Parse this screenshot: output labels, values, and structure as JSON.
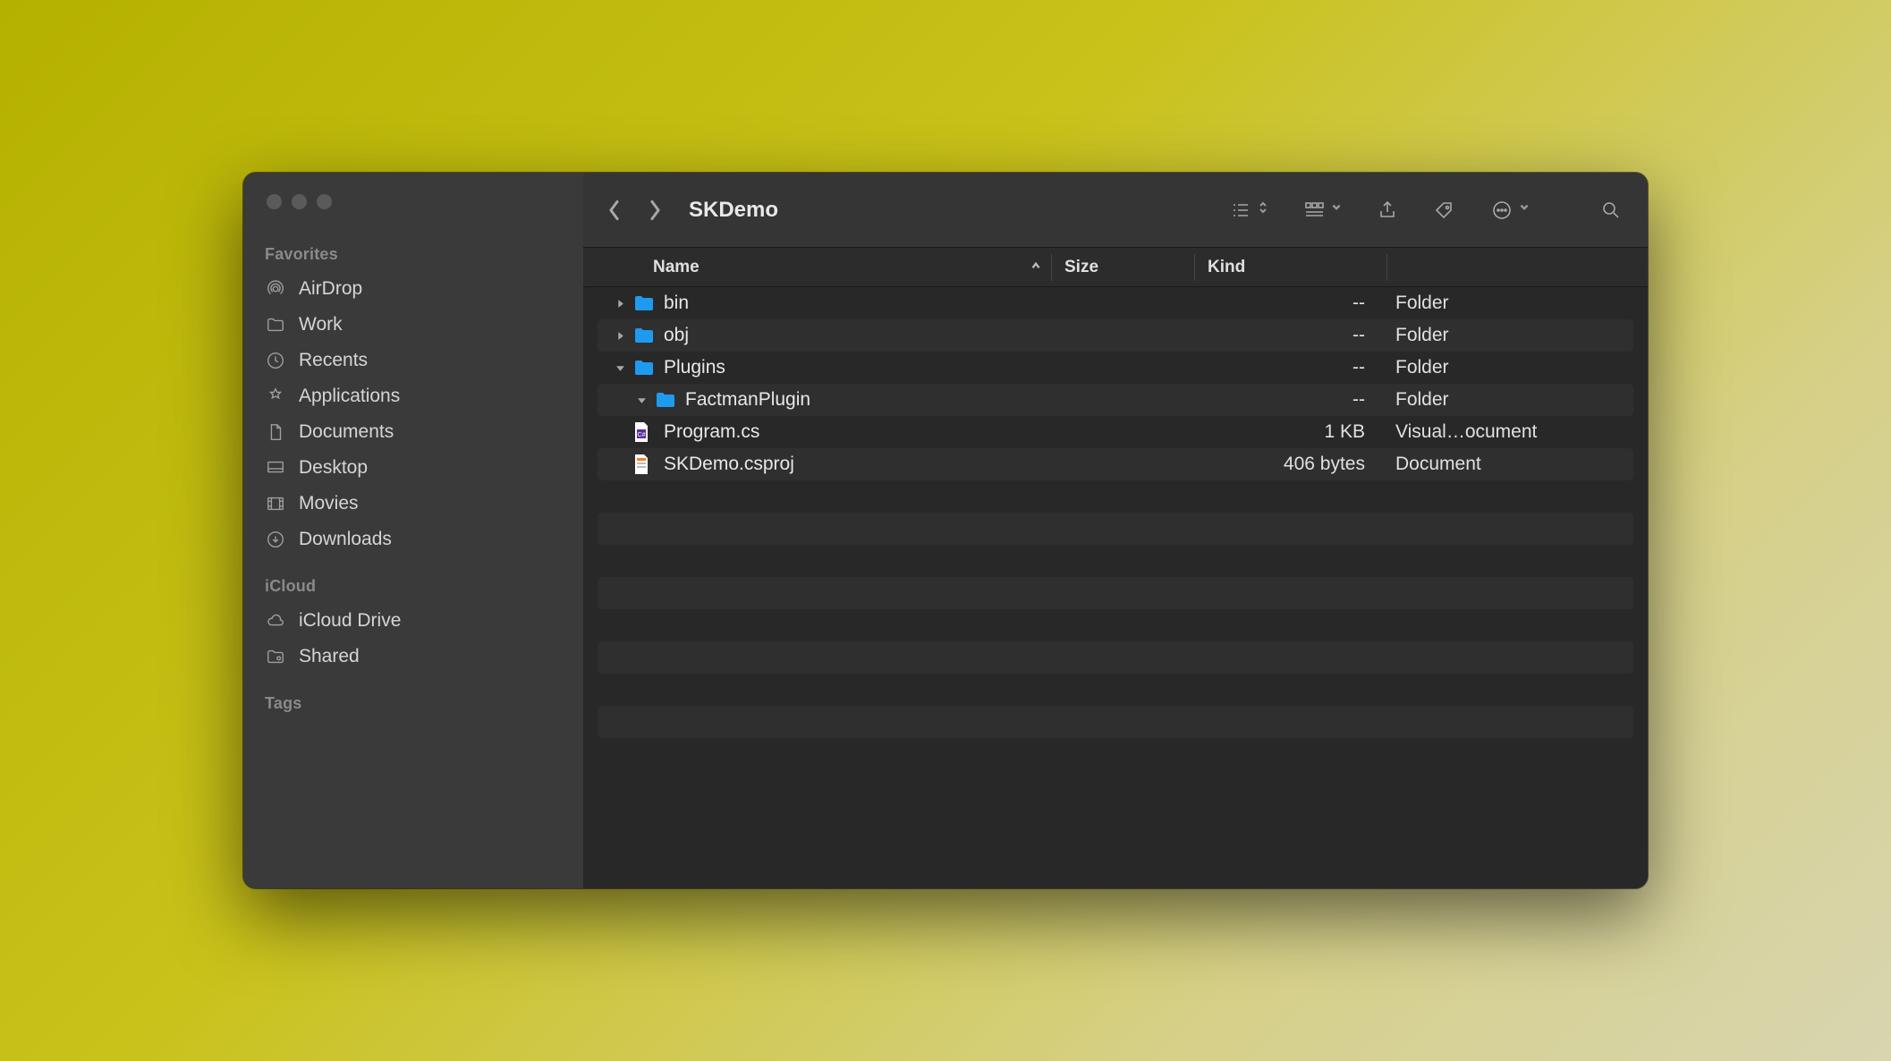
{
  "window": {
    "title": "SKDemo"
  },
  "sidebar": {
    "sections": [
      {
        "label": "Favorites",
        "items": [
          {
            "icon": "airdrop-icon",
            "label": "AirDrop"
          },
          {
            "icon": "folder-icon",
            "label": "Work"
          },
          {
            "icon": "clock-icon",
            "label": "Recents"
          },
          {
            "icon": "apps-icon",
            "label": "Applications"
          },
          {
            "icon": "document-icon",
            "label": "Documents"
          },
          {
            "icon": "desktop-icon",
            "label": "Desktop"
          },
          {
            "icon": "movies-icon",
            "label": "Movies"
          },
          {
            "icon": "download-icon",
            "label": "Downloads"
          }
        ]
      },
      {
        "label": "iCloud",
        "items": [
          {
            "icon": "cloud-icon",
            "label": "iCloud Drive"
          },
          {
            "icon": "shared-icon",
            "label": "Shared"
          }
        ]
      },
      {
        "label": "Tags",
        "items": []
      }
    ]
  },
  "columns": {
    "name": "Name",
    "size": "Size",
    "kind": "Kind",
    "sort": "asc"
  },
  "rows": [
    {
      "indent": 0,
      "disclosure": "closed",
      "icon": "folder",
      "name": "bin",
      "size": "--",
      "kind": "Folder"
    },
    {
      "indent": 0,
      "disclosure": "closed",
      "icon": "folder",
      "name": "obj",
      "size": "--",
      "kind": "Folder"
    },
    {
      "indent": 0,
      "disclosure": "open",
      "icon": "folder",
      "name": "Plugins",
      "size": "--",
      "kind": "Folder"
    },
    {
      "indent": 1,
      "disclosure": "open",
      "icon": "folder",
      "name": "FactmanPlugin",
      "size": "--",
      "kind": "Folder"
    },
    {
      "indent": 0,
      "disclosure": "none",
      "icon": "cs-file",
      "name": "Program.cs",
      "size": "1 KB",
      "kind": "Visual…ocument"
    },
    {
      "indent": 0,
      "disclosure": "none",
      "icon": "xml-file",
      "name": "SKDemo.csproj",
      "size": "406 bytes",
      "kind": "Document"
    }
  ],
  "empty_rows": 9,
  "colors": {
    "folder": "#1e9bf0",
    "sidebar_bg": "#3a3a3a",
    "main_bg": "#282828"
  }
}
